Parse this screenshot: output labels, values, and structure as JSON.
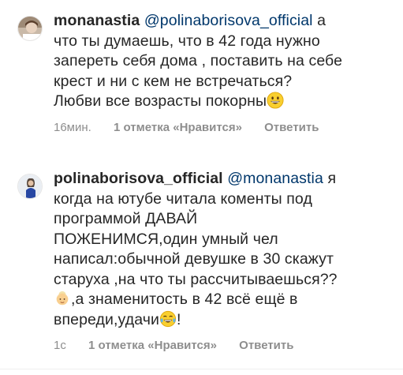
{
  "comments": [
    {
      "username": "monanastia",
      "mention": "@polinaborisova_official",
      "text_lines": [
        "а",
        "что ты думаешь, что в 42 года нужно",
        "запереть себя дома , поставить на себе",
        "крест и ни с кем не встречаться?",
        "Любви все возрасты покорны"
      ],
      "emoji_end": "grinning-face-icon",
      "time": "16мин.",
      "likes": "1 отметка «Нравится»",
      "reply": "Ответить"
    },
    {
      "username": "polinaborisova_official",
      "mention": "@monanastia",
      "text_lines": [
        "я",
        "когда на ютубе читала коменты под",
        "программой ДАВАЙ",
        "ПОЖЕНИМСЯ,один умный чел",
        "написал:обычной девушке в 30 скажут",
        "старуха ,на что ты рассчитываешься??",
        ",а знаменитость в 42 всё ещё в",
        "впереди,удачи",
        "!"
      ],
      "emoji_inline_1": "old-woman-icon",
      "emoji_inline_2": "tears-of-joy-icon",
      "time": "1с",
      "likes": "1 отметка «Нравится»",
      "reply": "Ответить"
    }
  ],
  "colors": {
    "text": "#262626",
    "mention": "#00376b",
    "meta": "#8e8e8e"
  }
}
